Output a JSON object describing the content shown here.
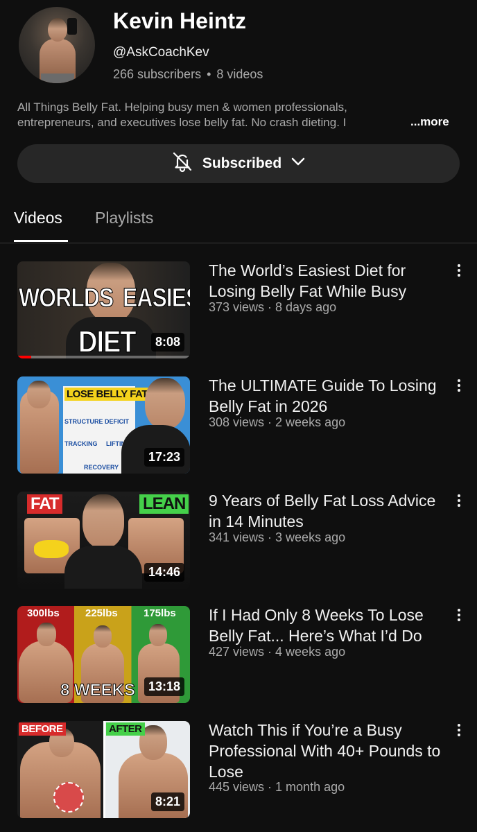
{
  "channel": {
    "name": "Kevin Heintz",
    "handle": "@AskCoachKev",
    "subscribers": "266 subscribers",
    "separator": "•",
    "videos_count": "8 videos",
    "description_line1": "All Things Belly Fat. Helping busy men & women professionals,",
    "description_line2": "entrepreneurs, and executives lose belly fat. No crash dieting. I",
    "more_label": "...more"
  },
  "subscribe": {
    "label": "Subscribed"
  },
  "tabs": [
    {
      "label": "Videos",
      "active": true
    },
    {
      "label": "Playlists",
      "active": false
    }
  ],
  "videos": [
    {
      "title": "The World’s Easiest Diet for Losing Belly Fat While Busy",
      "meta": "373 views · 8 days ago",
      "duration": "8:08",
      "progress": 0.08,
      "thumb_text": {
        "left": "WORLDS",
        "right": "EASIEST",
        "bottom": "DIET"
      }
    },
    {
      "title": "The ULTIMATE Guide To Losing Belly Fat in 2026",
      "meta": "308 views · 2 weeks ago",
      "duration": "17:23",
      "progress": 0.0,
      "thumb_text": {
        "banner": "LOSE BELLY FAT",
        "structure": "STRUCTURE",
        "deficit": "DEFICIT",
        "tracking": "TRACKING",
        "lifting": "LIFTIN",
        "recovery": "RECOVERY"
      }
    },
    {
      "title": "9 Years of Belly Fat Loss Advice in 14 Minutes",
      "meta": "341 views · 3 weeks ago",
      "duration": "14:46",
      "progress": 0.0,
      "thumb_text": {
        "left": "FAT",
        "right": "LEAN"
      }
    },
    {
      "title": "If I Had Only 8 Weeks To Lose Belly Fat... Here’s What I’d Do",
      "meta": "427 views · 4 weeks ago",
      "duration": "13:18",
      "progress": 0.0,
      "thumb_text": {
        "w1": "300lbs",
        "w2": "225lbs",
        "w3": "175lbs",
        "bottom": "8 WEEKS"
      }
    },
    {
      "title": "Watch This if You’re a Busy Professional With 40+ Pounds to Lose",
      "meta": "445 views · 1 month ago",
      "duration": "8:21",
      "progress": 0.0,
      "thumb_text": {
        "left": "BEFORE",
        "right": "AFTER"
      }
    }
  ],
  "colors": {
    "background": "#0f0f0f",
    "button": "#272727",
    "progress": "#ff0000",
    "muted_text": "#aaaaaa"
  },
  "icons": {
    "subscribe_bell": "bell-off-icon",
    "subscribe_chevron": "chevron-down-icon",
    "menu": "more-vert-icon"
  }
}
